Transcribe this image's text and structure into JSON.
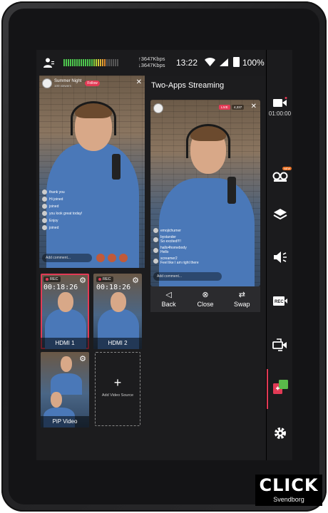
{
  "status_bar": {
    "bitrate_up": "3647Kbps",
    "bitrate_down": "3647Kbps",
    "time": "13:22",
    "battery": "100%",
    "icons": [
      "user-icon",
      "audio-level-meter",
      "upload-icon",
      "download-icon",
      "wifi-icon",
      "cellular-signal-icon",
      "battery-icon"
    ]
  },
  "main_preview": {
    "channel_name": "Summer Night",
    "channel_sub": "100 viewers",
    "follow_label": "Follow",
    "chat": [
      {
        "user": "",
        "text": "thank you"
      },
      {
        "user": "",
        "text": "Hi joined"
      },
      {
        "user": "",
        "text": "joined"
      },
      {
        "user": "",
        "text": "you look great today!"
      },
      {
        "user": "",
        "text": "Enjoy"
      },
      {
        "user": "",
        "text": "joined"
      }
    ],
    "comment_placeholder": "Add comment..."
  },
  "sources": [
    {
      "label": "HDMI 1",
      "rec": "REC",
      "time": "00:18:26",
      "active": true
    },
    {
      "label": "HDMI 2",
      "rec": "REC",
      "time": "00:18:26",
      "active": false
    },
    {
      "label": "PiP Video",
      "rec": "",
      "time": "",
      "active": false
    }
  ],
  "add_source_label": "Add Video Source",
  "right_panel": {
    "title": "Two-Apps Streaming",
    "preview": {
      "live_label": "LIVE",
      "viewers": "4,337",
      "chat": [
        {
          "user": "emojichurner",
          "text": ""
        },
        {
          "user": "bystander",
          "text": "So excited!!!!"
        },
        {
          "user": "hallo4homebody",
          "text": "Hello"
        },
        {
          "user": "screamer2",
          "text": "Feel like I am right there"
        }
      ],
      "comment_placeholder": "Add comment..."
    },
    "controls": [
      {
        "icon": "back-arrow-icon",
        "label": "Back"
      },
      {
        "icon": "close-circle-icon",
        "label": "Close"
      },
      {
        "icon": "swap-icon",
        "label": "Swap"
      }
    ]
  },
  "sidebar": {
    "record_time": "01:00:00",
    "new_badge": "NEW",
    "items": [
      "stream-camera-icon",
      "multicam-icon",
      "layers-icon",
      "audio-icon",
      "rec-icon",
      "switch-camera-icon",
      "two-apps-icon",
      "settings-icon"
    ]
  },
  "watermark": {
    "logo": "CLICK",
    "sub": "Svendborg"
  },
  "colors": {
    "accent_red": "#e23a55",
    "background": "#1c1c1e",
    "sidebar": "#1b1b1d",
    "new_badge": "#e86d1f",
    "two_apps_green": "#5ab94a"
  }
}
